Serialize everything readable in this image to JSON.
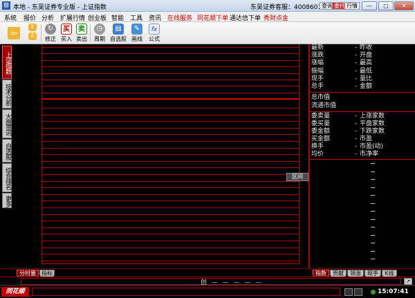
{
  "window": {
    "title": "本地 - 东吴证券专业版 - 上证指数",
    "hotline": "东吴证券客服：4008601555",
    "buttons": [
      "查询",
      "委托",
      "行情"
    ]
  },
  "menu": {
    "items": [
      "系统",
      "报价",
      "分析",
      "扩展行情",
      "创业板",
      "智能",
      "工具",
      "资讯"
    ],
    "red_items": [
      "在线服务",
      "同花顺下单",
      "通达信下单",
      "秀财点金"
    ]
  },
  "toolbar": {
    "tools": [
      {
        "name": "back-icon",
        "label": ""
      },
      {
        "name": "updown-icon",
        "label": ""
      },
      {
        "name": "revise",
        "label": "修正"
      },
      {
        "name": "buy",
        "label": "买入",
        "glyph": "买"
      },
      {
        "name": "sell",
        "label": "卖出",
        "glyph": "卖"
      },
      {
        "name": "period",
        "label": "周期"
      },
      {
        "name": "watchlist",
        "label": "自选股"
      },
      {
        "name": "draw",
        "label": "画线"
      },
      {
        "name": "formula",
        "label": "公式",
        "glyph": "fx"
      }
    ]
  },
  "side_tabs": [
    "上证指数",
    "技术分析",
    "大盘资讯",
    "自选股",
    "综合排名",
    "更多"
  ],
  "chart": {
    "range_button": "区间"
  },
  "right_panel": {
    "group1": [
      [
        "最新",
        "昨收"
      ],
      [
        "涨跌",
        "开盘"
      ],
      [
        "涨幅",
        "最高"
      ],
      [
        "振幅",
        "最低"
      ],
      [
        "现手",
        "量比"
      ],
      [
        "总手",
        "金额"
      ]
    ],
    "group2": [
      "总市值",
      "流通市值"
    ],
    "group3": [
      [
        "委卖量",
        "上涨家数"
      ],
      [
        "委买量",
        "平盘家数"
      ],
      [
        "委金额",
        "下跌家数"
      ],
      [
        "买金额",
        "市盈"
      ],
      [
        "换手",
        "市盈(动)"
      ],
      [
        "均价",
        "市净率"
      ]
    ],
    "dash": "-"
  },
  "bottom_tabs": {
    "left": [
      "分时量",
      "指标"
    ],
    "right": [
      "指数",
      "贡献",
      "领涨",
      "现手",
      "K线"
    ]
  },
  "status": {
    "ticker": "创   —   —   —   —   —",
    "logo": "同花顺",
    "time": "15:07:41"
  },
  "colors": {
    "grid": "#b00000",
    "panel_bg": "#000000",
    "active_tab": "#a40000",
    "accent_red": "#d10000"
  }
}
